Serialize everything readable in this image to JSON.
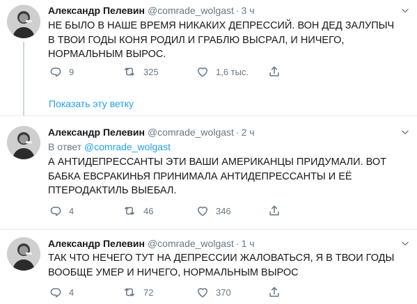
{
  "tweets": [
    {
      "name": "Александр Пелевин",
      "handle": "@comrade_wolgast",
      "dot": "·",
      "time": "3 ч",
      "reply_to_prefix": "",
      "reply_to_handle": "",
      "text": "НЕ БЫЛО В НАШЕ ВРЕМЯ НИКАКИХ ДЕПРЕССИЙ. ВОН ДЕД ЗАЛУПЫЧ В ТВОИ ГОДЫ КОНЯ РОДИЛ И ГРАБЛЮ ВЫСРАЛ, И НИЧЕГО, НОРМАЛЬНЫМ ВЫРОС.",
      "replies": "9",
      "retweets": "325",
      "likes": "1,6 тыс."
    },
    {
      "name": "Александр Пелевин",
      "handle": "@comrade_wolgast",
      "dot": "·",
      "time": "2 ч",
      "reply_to_prefix": "В ответ",
      "reply_to_handle": "@comrade_wolgast",
      "text": "А АНТИДЕПРЕССАНТЫ ЭТИ ВАШИ АМЕРИКАНЦЫ ПРИДУМАЛИ. ВОТ БАБКА ЕВСРАКИНЬЯ ПРИНИМАЛА АНТИДЕПРЕССАНТЫ И ЕЁ ПТЕРОДАКТИЛЬ ВЫЕБАЛ.",
      "replies": "4",
      "retweets": "46",
      "likes": "346"
    },
    {
      "name": "Александр Пелевин",
      "handle": "@comrade_wolgast",
      "dot": "·",
      "time": "1 ч",
      "reply_to_prefix": "",
      "reply_to_handle": "",
      "text": "ТАК ЧТО НЕЧЕГО ТУТ НА ДЕПРЕССИИ ЖАЛОВАТЬСЯ, Я В ТВОИ ГОДЫ ВООБЩЕ УМЕР И НИЧЕГО, НОРМАЛЬНЫМ ВЫРОС",
      "replies": "4",
      "retweets": "72",
      "likes": "370"
    }
  ],
  "show_thread_label": "Показать эту ветку",
  "icons": {
    "reply": "reply-icon",
    "retweet": "retweet-icon",
    "like": "heart-icon",
    "share": "share-icon",
    "more": "chevron-down-icon"
  },
  "colors": {
    "text": "#14171a",
    "secondary": "#657786",
    "link": "#1da1f2",
    "divider": "#e6ecf0"
  }
}
